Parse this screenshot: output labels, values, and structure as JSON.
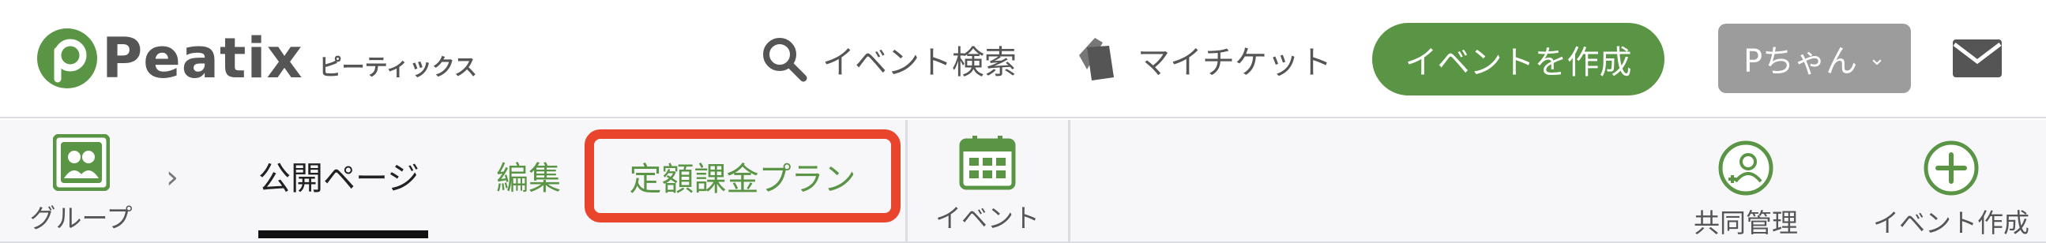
{
  "header": {
    "logo_text": "Peatix",
    "logo_kana": "ピーティックス",
    "search_label": "イベント検索",
    "tickets_label": "マイチケット",
    "create_event_label": "イベントを作成",
    "user_label": "Pちゃん",
    "accent_color": "#5a9545"
  },
  "subnav": {
    "group_label": "グループ",
    "tabs": [
      {
        "label": "公開ページ",
        "active": true
      },
      {
        "label": "編集",
        "active": false
      },
      {
        "label": "定額課金プラン",
        "active": false,
        "highlighted": true
      }
    ],
    "event_label": "イベント",
    "share_manage_label": "共同管理",
    "new_event_label": "イベント作成"
  }
}
